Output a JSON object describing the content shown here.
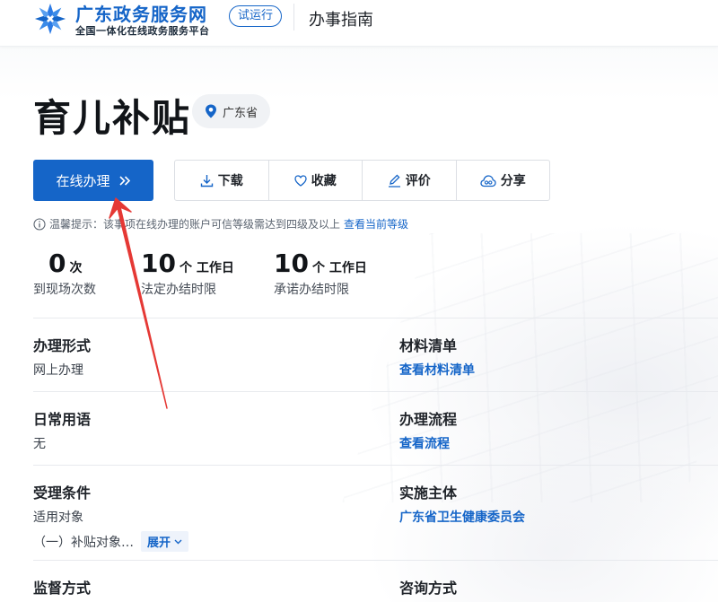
{
  "header": {
    "site_name": "广东政务服务网",
    "site_sub": "全国一体化在线政务服务平台",
    "trial_badge": "试运行",
    "nav_title": "办事指南"
  },
  "page": {
    "title": "育儿补贴",
    "region": "广东省"
  },
  "actions": {
    "online": "在线办理",
    "download": "下载",
    "favorite": "收藏",
    "review": "评价",
    "share": "分享"
  },
  "notice": {
    "text": "温馨提示：该事项在线办理的账户可信等级需达到四级及以上",
    "link": "查看当前等级"
  },
  "stats": [
    {
      "value": "0",
      "unit": "次",
      "label": "到现场次数"
    },
    {
      "value": "10",
      "unit": "个 工作日",
      "label": "法定办结时限"
    },
    {
      "value": "10",
      "unit": "个 工作日",
      "label": "承诺办结时限"
    }
  ],
  "info": {
    "handling_form": {
      "heading": "办理形式",
      "value": "网上办理"
    },
    "materials": {
      "heading": "材料清单",
      "link": "查看材料清单"
    },
    "common_terms": {
      "heading": "日常用语",
      "value": "无"
    },
    "process": {
      "heading": "办理流程",
      "link": "查看流程"
    },
    "conditions": {
      "heading": "受理条件",
      "value": "适用对象",
      "sub_value": "（一）补贴对象…",
      "expand": "展开"
    },
    "implementer": {
      "heading": "实施主体",
      "link": "广东省卫生健康委员会"
    },
    "supervision": {
      "heading": "监督方式"
    },
    "consultation": {
      "heading": "咨询方式"
    }
  },
  "colors": {
    "brand": "#1565c8",
    "annotation_arrow": "#e53935"
  }
}
